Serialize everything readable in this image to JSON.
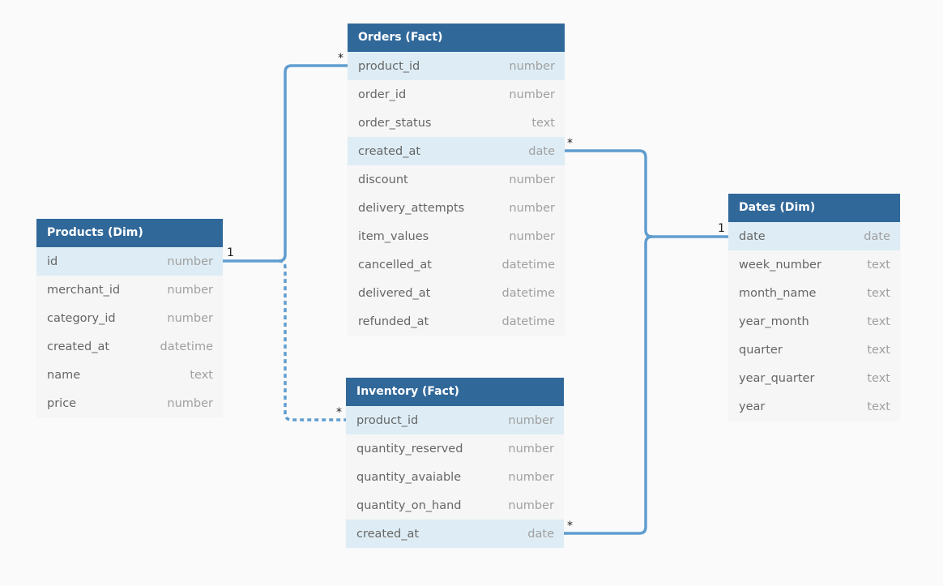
{
  "tables": [
    {
      "id": "orders",
      "title": "Orders (Fact)",
      "fields": [
        {
          "name": "product_id",
          "type": "number",
          "key": true
        },
        {
          "name": "order_id",
          "type": "number"
        },
        {
          "name": "order_status",
          "type": "text"
        },
        {
          "name": "created_at",
          "type": "date",
          "key": true
        },
        {
          "name": "discount",
          "type": "number"
        },
        {
          "name": "delivery_attempts",
          "type": "number"
        },
        {
          "name": "item_values",
          "type": "number"
        },
        {
          "name": "cancelled_at",
          "type": "datetime"
        },
        {
          "name": "delivered_at",
          "type": "datetime"
        },
        {
          "name": "refunded_at",
          "type": "datetime"
        }
      ]
    },
    {
      "id": "products",
      "title": "Products (Dim)",
      "fields": [
        {
          "name": "id",
          "type": "number",
          "key": true
        },
        {
          "name": "merchant_id",
          "type": "number"
        },
        {
          "name": "category_id",
          "type": "number"
        },
        {
          "name": "created_at",
          "type": "datetime"
        },
        {
          "name": "name",
          "type": "text"
        },
        {
          "name": "price",
          "type": "number"
        }
      ]
    },
    {
      "id": "inventory",
      "title": "Inventory (Fact)",
      "fields": [
        {
          "name": "product_id",
          "type": "number",
          "key": true
        },
        {
          "name": "quantity_reserved",
          "type": "number"
        },
        {
          "name": "quantity_avaiable",
          "type": "number"
        },
        {
          "name": "quantity_on_hand",
          "type": "number"
        },
        {
          "name": "created_at",
          "type": "date",
          "key": true
        }
      ]
    },
    {
      "id": "dates",
      "title": "Dates (Dim)",
      "fields": [
        {
          "name": "date",
          "type": "date",
          "key": true
        },
        {
          "name": "week_number",
          "type": "text"
        },
        {
          "name": "month_name",
          "type": "text"
        },
        {
          "name": "year_month",
          "type": "text"
        },
        {
          "name": "quarter",
          "type": "text"
        },
        {
          "name": "year_quarter",
          "type": "text"
        },
        {
          "name": "year",
          "type": "text"
        }
      ]
    }
  ],
  "relationships": [
    {
      "from": "products.id",
      "to": "orders.product_id",
      "from_card": "1",
      "to_card": "*",
      "style": "solid"
    },
    {
      "from": "products.id",
      "to": "inventory.product_id",
      "from_card": "1",
      "to_card": "*",
      "style": "dashed"
    },
    {
      "from": "dates.date",
      "to": "orders.created_at",
      "from_card": "1",
      "to_card": "*",
      "style": "solid"
    },
    {
      "from": "dates.date",
      "to": "inventory.created_at",
      "from_card": "1",
      "to_card": "*",
      "style": "solid"
    }
  ],
  "colors": {
    "header": "#31689a",
    "key_row": "#deedf5",
    "row": "#f6f6f6",
    "line": "#609dcf"
  }
}
